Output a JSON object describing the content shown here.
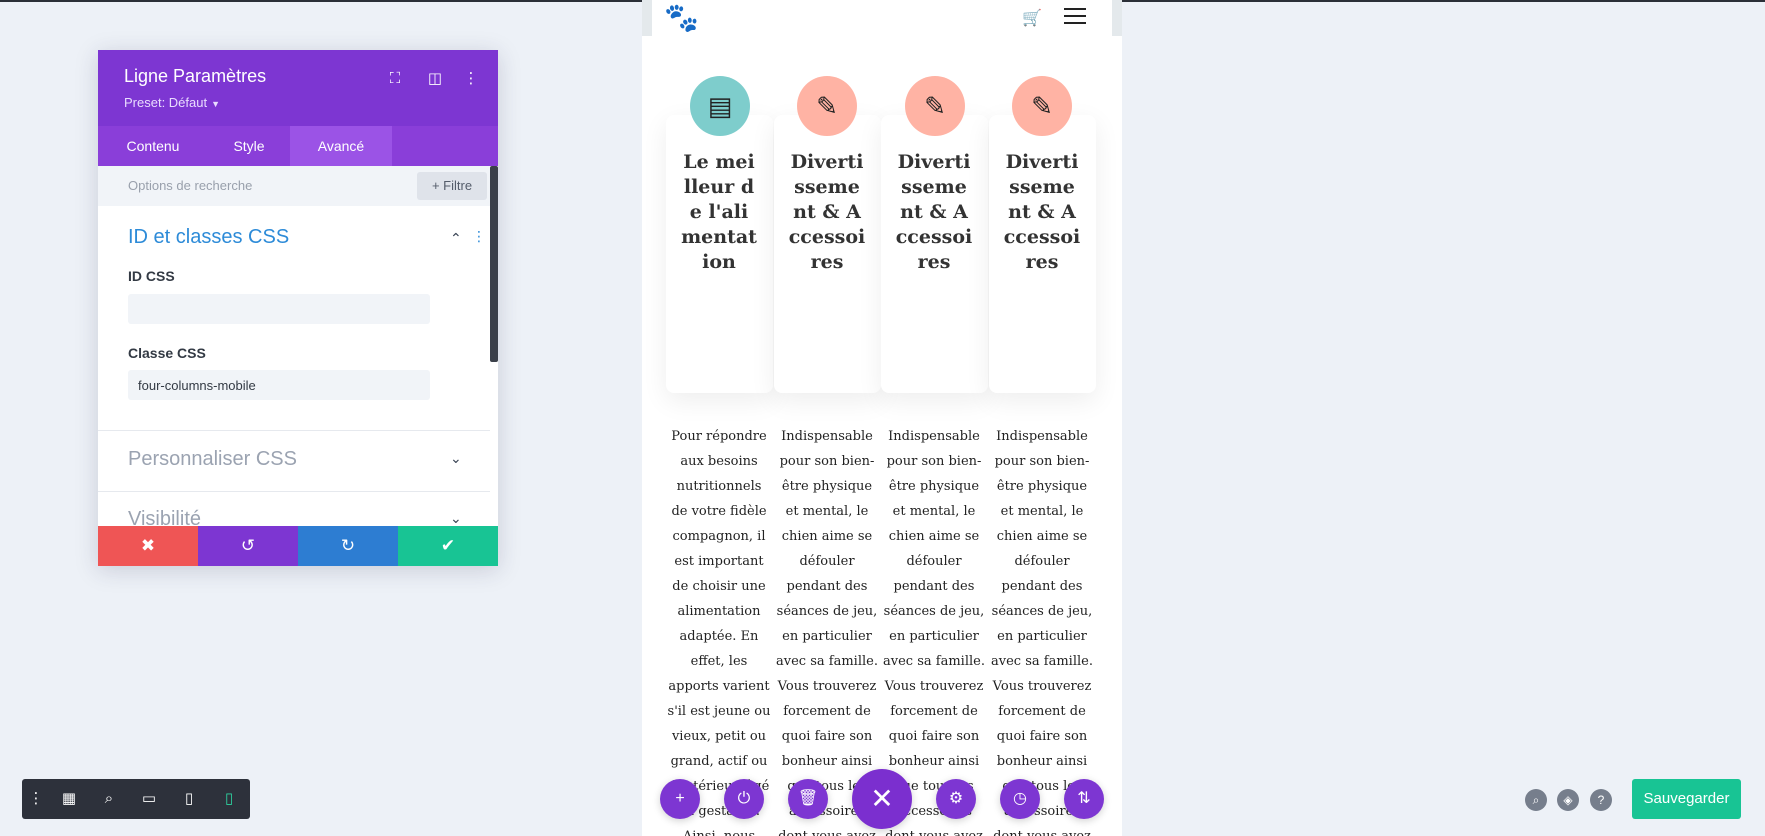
{
  "settings_panel": {
    "title": "Ligne Paramètres",
    "preset": "Preset: Défaut",
    "header_icons": [
      "fullscreen-icon",
      "split-view-icon",
      "more-options-icon"
    ],
    "tabs": [
      {
        "label": "Contenu",
        "active": false
      },
      {
        "label": "Style",
        "active": false
      },
      {
        "label": "Avancé",
        "active": true
      }
    ],
    "search": {
      "placeholder": "Options de recherche",
      "filter_label": "+ Filtre"
    },
    "sections": [
      {
        "title": "ID et classes CSS",
        "expanded": true,
        "fields": [
          {
            "label": "ID CSS",
            "value": ""
          },
          {
            "label": "Classe CSS",
            "value": "four-columns-mobile"
          }
        ]
      },
      {
        "title": "Personnaliser CSS",
        "expanded": false
      },
      {
        "title": "Visibilité",
        "expanded": false
      }
    ],
    "actions": [
      {
        "name": "cancel",
        "icon": "close-icon",
        "color": "#ef5555",
        "glyph": "✖"
      },
      {
        "name": "undo",
        "icon": "undo-icon",
        "color": "#7d36d2",
        "glyph": "↺"
      },
      {
        "name": "redo",
        "icon": "redo-icon",
        "color": "#2d7dd2",
        "glyph": "↻"
      },
      {
        "name": "confirm",
        "icon": "check-icon",
        "color": "#18c494",
        "glyph": "✔"
      }
    ]
  },
  "bottom_toolbar": {
    "items": [
      {
        "name": "more-options-icon",
        "glyph": "⋮"
      },
      {
        "name": "layout-icon",
        "glyph": "▦"
      },
      {
        "name": "zoom-icon",
        "glyph": "⌕"
      },
      {
        "name": "desktop-view-icon",
        "glyph": "▭"
      },
      {
        "name": "tablet-view-icon",
        "glyph": "▯"
      },
      {
        "name": "phone-view-icon",
        "glyph": "▯",
        "active": true
      }
    ]
  },
  "preview": {
    "header": {
      "logo_icon": "paw-icon",
      "cart_icon": "cart-icon",
      "menu_icon": "hamburger-menu-icon"
    },
    "cards": [
      {
        "icon": "pet-food-icon",
        "icon_color": "#7ecdcc",
        "glyph": "▤",
        "title": "Le meilleur de l'alimentation",
        "text": "Pour répondre aux besoins nutritionnels de votre fidèle compagnon, il est important de choisir une alimentation adaptée. En effet, les apports varient s'il est jeune ou vieux, petit ou grand, actif ou d'intérieur, âgé ou gestant... Ainsi, nous vous chaque"
      },
      {
        "icon": "dog-toy-icon",
        "icon_color": "#ffb3a4",
        "glyph": "✎",
        "title": "Divertissement & Accessoires",
        "text": "Indispensable pour son bien-être physique et mental, le chien aime se défouler pendant des séances de jeu, en particulier avec sa famille. Vous trouverez forcement de quoi faire son bonheur ainsi que tous les accessoires dont vous avez besoin pour"
      },
      {
        "icon": "dog-toy-icon",
        "icon_color": "#ffb3a4",
        "glyph": "✎",
        "title": "Divertissement & Accessoires",
        "text": "Indispensable pour son bien-être physique et mental, le chien aime se défouler pendant des séances de jeu, en particulier avec sa famille. Vous trouverez forcement de quoi faire son bonheur ainsi que tous les accessoires dont vous avez besoin pour"
      },
      {
        "icon": "dog-toy-icon",
        "icon_color": "#ffb3a4",
        "glyph": "✎",
        "title": "Divertissement & Accessoires",
        "text": "Indispensable pour son bien-être physique et mental, le chien aime se défouler pendant des séances de jeu, en particulier avec sa famille. Vous trouverez forcement de quoi faire son bonheur ainsi que tous les accessoires dont vous avez besoin pour"
      }
    ]
  },
  "floating_buttons": [
    {
      "name": "add-icon",
      "glyph": "+"
    },
    {
      "name": "power-icon",
      "glyph": "⏻"
    },
    {
      "name": "trash-icon",
      "glyph": "🗑"
    },
    {
      "name": "close-icon",
      "glyph": "✕"
    },
    {
      "name": "settings-icon",
      "glyph": "⚙"
    },
    {
      "name": "history-icon",
      "glyph": "◷"
    },
    {
      "name": "sort-icon",
      "glyph": "⇅"
    }
  ],
  "right_tools": {
    "icons": [
      {
        "name": "zoom-icon",
        "glyph": "⌕"
      },
      {
        "name": "layers-icon",
        "glyph": "◈"
      },
      {
        "name": "help-icon",
        "glyph": "?"
      }
    ],
    "save_label": "Sauvegarder"
  }
}
